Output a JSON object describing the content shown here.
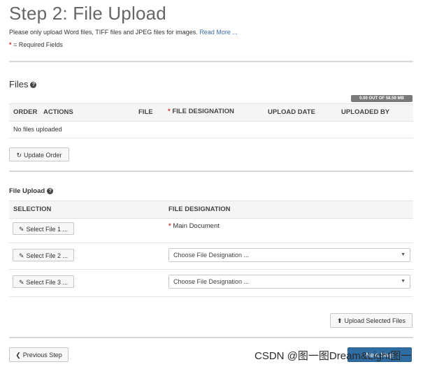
{
  "header": {
    "title": "Step 2: File Upload",
    "note": "Please only upload Word files, TIFF files and JPEG files for images.",
    "read_more": "Read More ...",
    "required_star": "*",
    "required_text": "= Required Fields"
  },
  "files": {
    "heading": "Files",
    "help_icon": "?",
    "quota": "0.00 OUT OF 58.59 MB",
    "columns": [
      "ORDER",
      "ACTIONS",
      "FILE",
      "FILE DESIGNATION",
      "UPLOAD DATE",
      "UPLOADED BY"
    ],
    "designation_star": "*",
    "empty_text": "No files uploaded",
    "update_order_label": "Update Order"
  },
  "upload": {
    "heading": "File Upload",
    "help_icon": "?",
    "columns": [
      "SELECTION",
      "FILE DESIGNATION"
    ],
    "rows": [
      {
        "button": "Select File 1 ...",
        "designation": "Main Document",
        "required": "*"
      },
      {
        "button": "Select File 2 ...",
        "designation": "Choose File Designation ..."
      },
      {
        "button": "Select File 3 ...",
        "designation": "Choose File Designation ..."
      }
    ],
    "upload_label": "Upload Selected Files"
  },
  "footer": {
    "previous_label": "Previous Step",
    "next_label": "Next Step"
  },
  "watermark": "CSDN @图一图Dream&Light图一"
}
